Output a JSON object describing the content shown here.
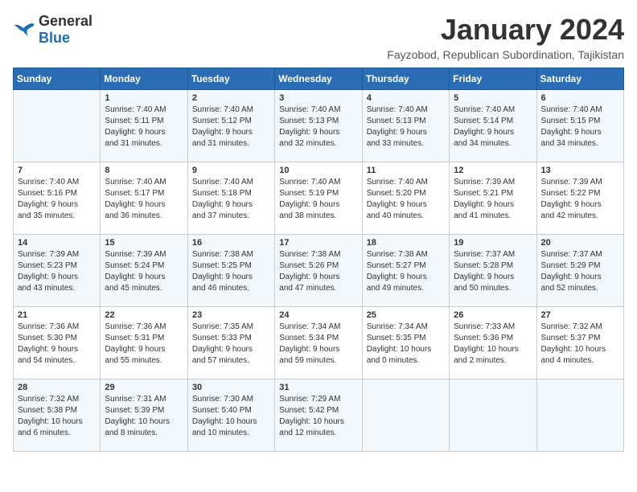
{
  "logo": {
    "general": "General",
    "blue": "Blue"
  },
  "title": "January 2024",
  "subtitle": "Fayzobod, Republican Subordination, Tajikistan",
  "days_header": [
    "Sunday",
    "Monday",
    "Tuesday",
    "Wednesday",
    "Thursday",
    "Friday",
    "Saturday"
  ],
  "weeks": [
    [
      {
        "day": "",
        "info": ""
      },
      {
        "day": "1",
        "info": "Sunrise: 7:40 AM\nSunset: 5:11 PM\nDaylight: 9 hours\nand 31 minutes."
      },
      {
        "day": "2",
        "info": "Sunrise: 7:40 AM\nSunset: 5:12 PM\nDaylight: 9 hours\nand 31 minutes."
      },
      {
        "day": "3",
        "info": "Sunrise: 7:40 AM\nSunset: 5:13 PM\nDaylight: 9 hours\nand 32 minutes."
      },
      {
        "day": "4",
        "info": "Sunrise: 7:40 AM\nSunset: 5:13 PM\nDaylight: 9 hours\nand 33 minutes."
      },
      {
        "day": "5",
        "info": "Sunrise: 7:40 AM\nSunset: 5:14 PM\nDaylight: 9 hours\nand 34 minutes."
      },
      {
        "day": "6",
        "info": "Sunrise: 7:40 AM\nSunset: 5:15 PM\nDaylight: 9 hours\nand 34 minutes."
      }
    ],
    [
      {
        "day": "7",
        "info": "Sunrise: 7:40 AM\nSunset: 5:16 PM\nDaylight: 9 hours\nand 35 minutes."
      },
      {
        "day": "8",
        "info": "Sunrise: 7:40 AM\nSunset: 5:17 PM\nDaylight: 9 hours\nand 36 minutes."
      },
      {
        "day": "9",
        "info": "Sunrise: 7:40 AM\nSunset: 5:18 PM\nDaylight: 9 hours\nand 37 minutes."
      },
      {
        "day": "10",
        "info": "Sunrise: 7:40 AM\nSunset: 5:19 PM\nDaylight: 9 hours\nand 38 minutes."
      },
      {
        "day": "11",
        "info": "Sunrise: 7:40 AM\nSunset: 5:20 PM\nDaylight: 9 hours\nand 40 minutes."
      },
      {
        "day": "12",
        "info": "Sunrise: 7:39 AM\nSunset: 5:21 PM\nDaylight: 9 hours\nand 41 minutes."
      },
      {
        "day": "13",
        "info": "Sunrise: 7:39 AM\nSunset: 5:22 PM\nDaylight: 9 hours\nand 42 minutes."
      }
    ],
    [
      {
        "day": "14",
        "info": "Sunrise: 7:39 AM\nSunset: 5:23 PM\nDaylight: 9 hours\nand 43 minutes."
      },
      {
        "day": "15",
        "info": "Sunrise: 7:39 AM\nSunset: 5:24 PM\nDaylight: 9 hours\nand 45 minutes."
      },
      {
        "day": "16",
        "info": "Sunrise: 7:38 AM\nSunset: 5:25 PM\nDaylight: 9 hours\nand 46 minutes."
      },
      {
        "day": "17",
        "info": "Sunrise: 7:38 AM\nSunset: 5:26 PM\nDaylight: 9 hours\nand 47 minutes."
      },
      {
        "day": "18",
        "info": "Sunrise: 7:38 AM\nSunset: 5:27 PM\nDaylight: 9 hours\nand 49 minutes."
      },
      {
        "day": "19",
        "info": "Sunrise: 7:37 AM\nSunset: 5:28 PM\nDaylight: 9 hours\nand 50 minutes."
      },
      {
        "day": "20",
        "info": "Sunrise: 7:37 AM\nSunset: 5:29 PM\nDaylight: 9 hours\nand 52 minutes."
      }
    ],
    [
      {
        "day": "21",
        "info": "Sunrise: 7:36 AM\nSunset: 5:30 PM\nDaylight: 9 hours\nand 54 minutes."
      },
      {
        "day": "22",
        "info": "Sunrise: 7:36 AM\nSunset: 5:31 PM\nDaylight: 9 hours\nand 55 minutes."
      },
      {
        "day": "23",
        "info": "Sunrise: 7:35 AM\nSunset: 5:33 PM\nDaylight: 9 hours\nand 57 minutes."
      },
      {
        "day": "24",
        "info": "Sunrise: 7:34 AM\nSunset: 5:34 PM\nDaylight: 9 hours\nand 59 minutes."
      },
      {
        "day": "25",
        "info": "Sunrise: 7:34 AM\nSunset: 5:35 PM\nDaylight: 10 hours\nand 0 minutes."
      },
      {
        "day": "26",
        "info": "Sunrise: 7:33 AM\nSunset: 5:36 PM\nDaylight: 10 hours\nand 2 minutes."
      },
      {
        "day": "27",
        "info": "Sunrise: 7:32 AM\nSunset: 5:37 PM\nDaylight: 10 hours\nand 4 minutes."
      }
    ],
    [
      {
        "day": "28",
        "info": "Sunrise: 7:32 AM\nSunset: 5:38 PM\nDaylight: 10 hours\nand 6 minutes."
      },
      {
        "day": "29",
        "info": "Sunrise: 7:31 AM\nSunset: 5:39 PM\nDaylight: 10 hours\nand 8 minutes."
      },
      {
        "day": "30",
        "info": "Sunrise: 7:30 AM\nSunset: 5:40 PM\nDaylight: 10 hours\nand 10 minutes."
      },
      {
        "day": "31",
        "info": "Sunrise: 7:29 AM\nSunset: 5:42 PM\nDaylight: 10 hours\nand 12 minutes."
      },
      {
        "day": "",
        "info": ""
      },
      {
        "day": "",
        "info": ""
      },
      {
        "day": "",
        "info": ""
      }
    ]
  ]
}
